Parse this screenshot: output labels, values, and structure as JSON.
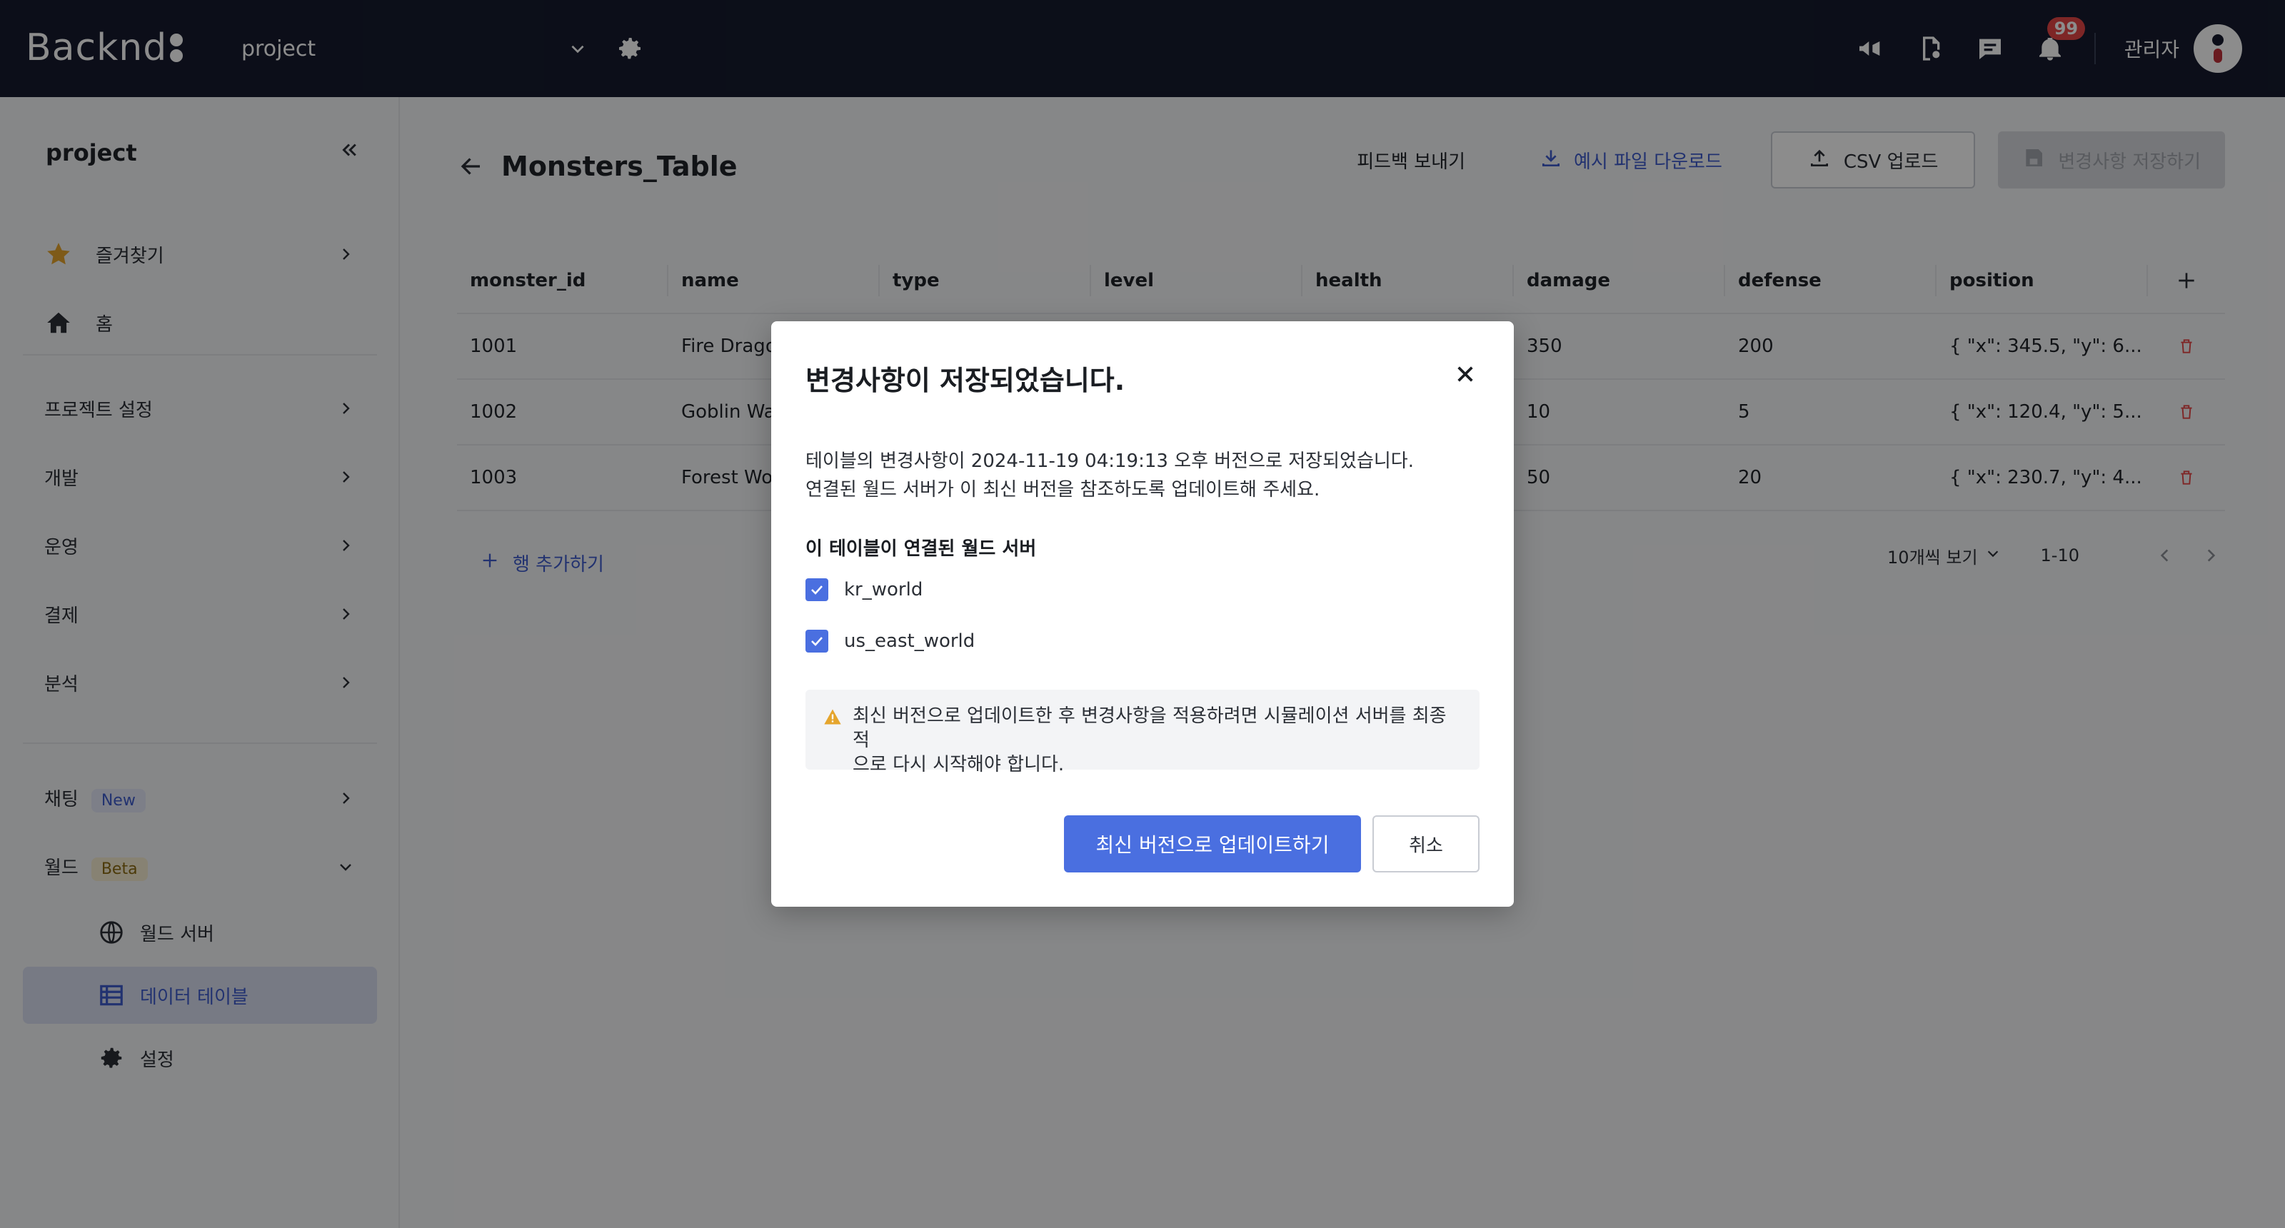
{
  "topbar": {
    "logo_text": "Backnd",
    "project": "project",
    "notification_count": "99",
    "admin_label": "관리자"
  },
  "sidebar": {
    "header": "project",
    "items": [
      {
        "label": "즐겨찾기"
      },
      {
        "label": "홈"
      },
      {
        "label": "프로젝트 설정"
      },
      {
        "label": "개발"
      },
      {
        "label": "운영"
      },
      {
        "label": "결제"
      },
      {
        "label": "분석"
      },
      {
        "label": "채팅",
        "tag": "New"
      },
      {
        "label": "월드",
        "tag": "Beta"
      }
    ],
    "sub_items": [
      {
        "label": "월드 서버"
      },
      {
        "label": "데이터 테이블"
      },
      {
        "label": "설정"
      }
    ]
  },
  "main": {
    "title": "Monsters_Table",
    "feedback": "피드백 보내기",
    "download_sample": "예시 파일 다운로드",
    "csv_upload": "CSV 업로드",
    "save_changes": "변경사항 저장하기",
    "columns": [
      "monster_id",
      "name",
      "type",
      "level",
      "health",
      "damage",
      "defense",
      "position"
    ],
    "rows": [
      [
        "1001",
        "Fire Dragon",
        "",
        "",
        "",
        "350",
        "200",
        "{ \"x\": 345.5, \"y\": 6..."
      ],
      [
        "1002",
        "Goblin Warrior",
        "",
        "",
        "",
        "10",
        "5",
        "{ \"x\": 120.4, \"y\": 5..."
      ],
      [
        "1003",
        "Forest Wolf",
        "",
        "",
        "",
        "50",
        "20",
        "{ \"x\": 230.7, \"y\": 4..."
      ]
    ],
    "add_row": "행 추가하기",
    "page_size": "10개씩 보기",
    "page_range": "1-10"
  },
  "modal": {
    "title": "변경사항이 저장되었습니다.",
    "desc_line1": "테이블의 변경사항이 2024-11-19 04:19:13 오후 버전으로 저장되었습니다.",
    "desc_line2": "연결된 월드 서버가 이 최신 버전을 참조하도록 업데이트해 주세요.",
    "servers_label": "이 테이블이 연결된 월드 서버",
    "servers": [
      "kr_world",
      "us_east_world"
    ],
    "warning_line1": "최신 버전으로 업데이트한 후 변경사항을 적용하려면 시뮬레이션 서버를 최종적",
    "warning_line2": "으로 다시 시작해야 합니다.",
    "primary_button": "최신 버전으로 업데이트하기",
    "cancel_button": "취소"
  },
  "colors": {
    "topbar_bg": "#161b2e",
    "accent": "#4a6fe0",
    "link_blue": "#3e5ccc",
    "danger": "#e64646"
  }
}
